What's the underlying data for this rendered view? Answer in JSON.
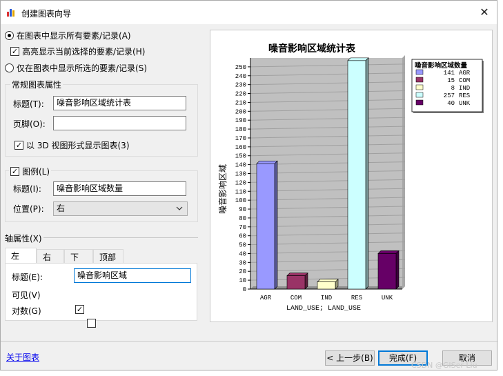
{
  "window": {
    "title": "创建图表向导",
    "close_glyph": "✕"
  },
  "display_options": {
    "show_all": "在图表中显示所有要素/记录(A)",
    "highlight_selected": "高亮显示当前选择的要素/记录(H)",
    "show_selected_only": "仅在图表中显示所选的要素/记录(S)"
  },
  "general": {
    "group_title": "常规图表属性",
    "title_label": "标题(T):",
    "title_value": "噪音影响区域统计表",
    "footer_label": "页脚(O):",
    "footer_value": "",
    "show3d_label": "以 3D 视图形式显示图表(3)"
  },
  "legend": {
    "group_title": "图例(L)",
    "title_label": "标题(I):",
    "title_value": "噪音影响区域数量",
    "position_label": "位置(P):",
    "position_value": "右"
  },
  "axis": {
    "section_title": "轴属性(X)",
    "tabs": [
      "左",
      "右",
      "下",
      "顶部"
    ],
    "title_label": "标题(E):",
    "title_value": "噪音影响区域",
    "visible_label": "可见(V)",
    "log_label": "对数(G)"
  },
  "footer": {
    "about_link": "关于图表",
    "back_button": "< 上一步(B)",
    "finish_button": "完成(F)",
    "cancel_button": "取消"
  },
  "watermark": "CSDN @GISer Liu",
  "colors": {
    "AGR": "#9999ff",
    "COM": "#993366",
    "IND": "#ffffcc",
    "RES": "#ccffff",
    "UNK": "#660066"
  },
  "chart_data": {
    "type": "bar",
    "title": "噪音影响区域统计表",
    "xlabel": "LAND_USE; LAND_USE",
    "ylabel": "噪音影响区域",
    "categories": [
      "AGR",
      "COM",
      "IND",
      "RES",
      "UNK"
    ],
    "values": [
      141,
      15,
      8,
      257,
      40
    ],
    "ylim": [
      0,
      260
    ],
    "yticks": [
      0,
      10,
      20,
      30,
      40,
      50,
      60,
      70,
      80,
      90,
      100,
      110,
      120,
      130,
      140,
      150,
      160,
      170,
      180,
      190,
      200,
      210,
      220,
      230,
      240,
      250
    ],
    "grid": true,
    "legend_title": "噪音影响区域数量",
    "legend_position": "top-right"
  }
}
